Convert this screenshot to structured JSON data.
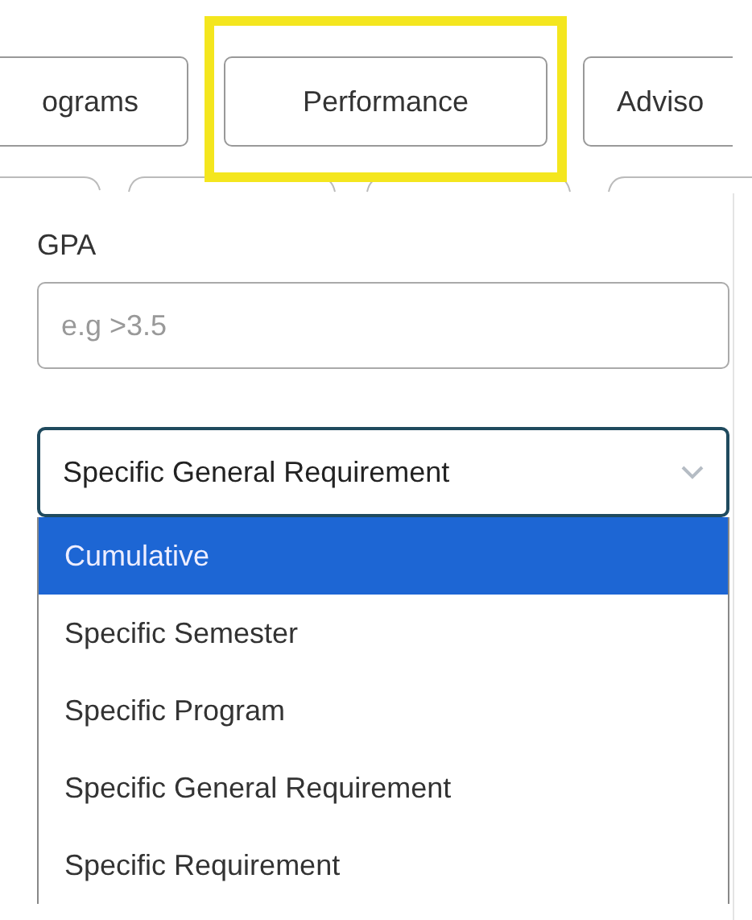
{
  "tabs": [
    {
      "label": "ograms",
      "highlighted": false
    },
    {
      "label": "Performance",
      "highlighted": true
    },
    {
      "label": "Adviso",
      "highlighted": false
    }
  ],
  "gpa": {
    "label": "GPA",
    "placeholder": "e.g >3.5"
  },
  "gpa_type": {
    "value": "Specific General Requirement",
    "expanded": true,
    "options": [
      {
        "label": "Cumulative",
        "highlighted": true
      },
      {
        "label": "Specific Semester",
        "highlighted": false
      },
      {
        "label": "Specific Program",
        "highlighted": false
      },
      {
        "label": "Specific General Requirement",
        "highlighted": false
      },
      {
        "label": "Specific Requirement",
        "highlighted": false
      }
    ]
  }
}
